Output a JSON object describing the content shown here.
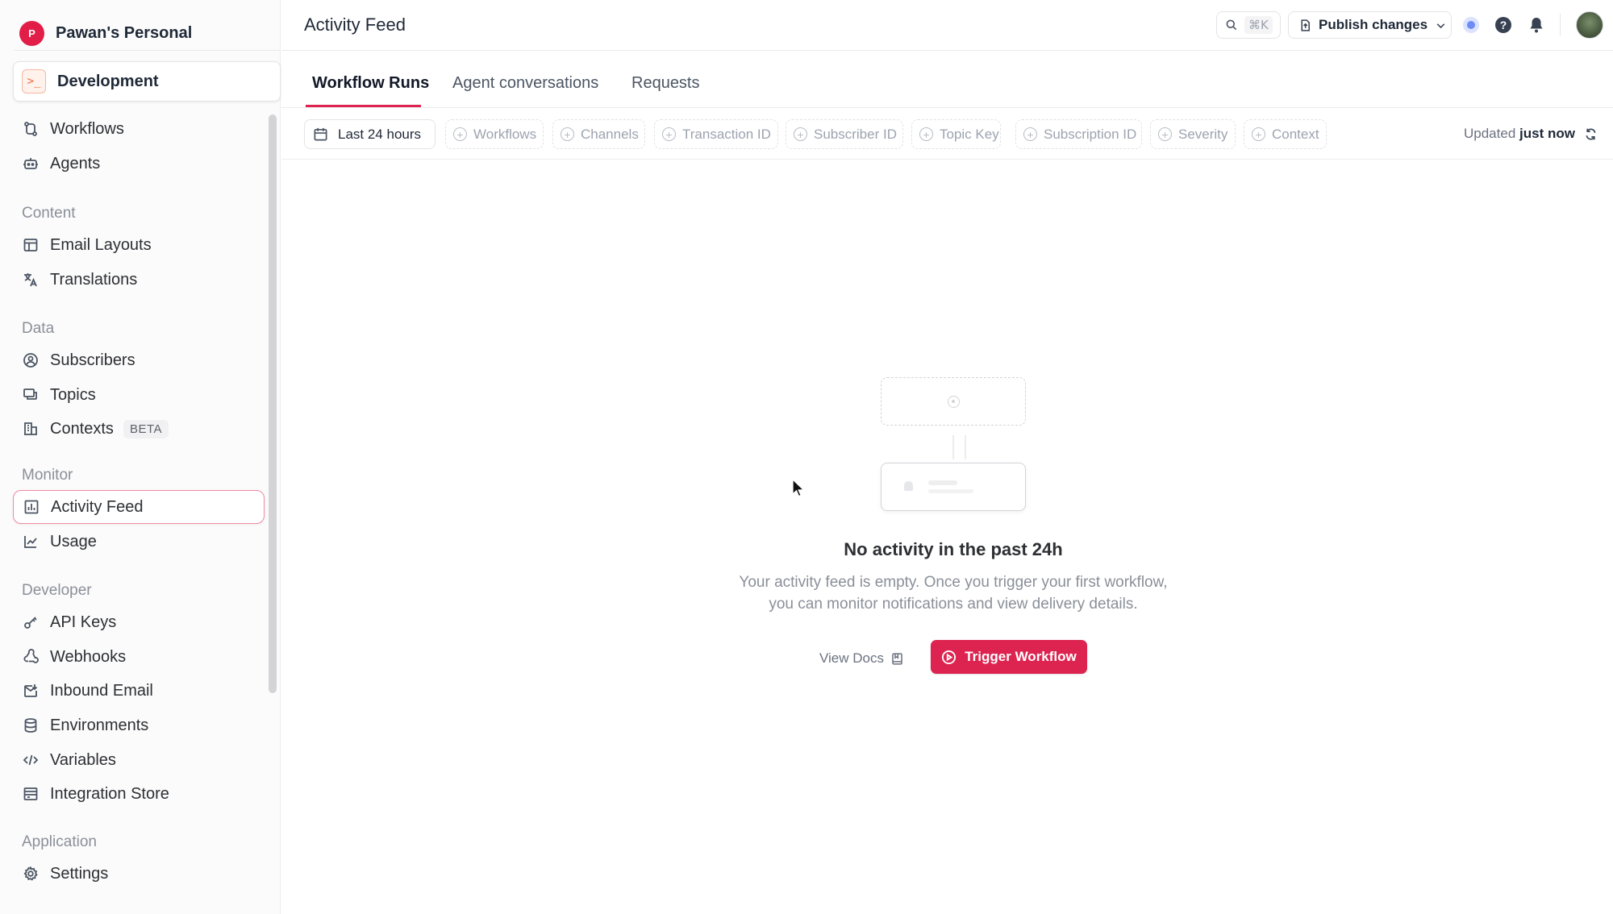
{
  "org": {
    "initial": "P",
    "name": "Pawan's Personal"
  },
  "environment": {
    "icon": ">_",
    "label": "Development"
  },
  "sidebar": {
    "top_items": [
      {
        "label": "Workflows",
        "icon": "workflow-icon"
      },
      {
        "label": "Agents",
        "icon": "bot-icon"
      }
    ],
    "sections": {
      "content": {
        "title": "Content",
        "items": [
          {
            "label": "Email Layouts"
          },
          {
            "label": "Translations"
          }
        ]
      },
      "data": {
        "title": "Data",
        "items": [
          {
            "label": "Subscribers"
          },
          {
            "label": "Topics"
          },
          {
            "label": "Contexts",
            "badge": "BETA"
          }
        ]
      },
      "monitor": {
        "title": "Monitor",
        "items": [
          {
            "label": "Activity Feed"
          },
          {
            "label": "Usage"
          }
        ]
      },
      "developer": {
        "title": "Developer",
        "items": [
          {
            "label": "API Keys"
          },
          {
            "label": "Webhooks"
          },
          {
            "label": "Inbound Email"
          },
          {
            "label": "Environments"
          },
          {
            "label": "Variables"
          },
          {
            "label": "Integration Store"
          }
        ]
      },
      "application": {
        "title": "Application",
        "items": [
          {
            "label": "Settings"
          }
        ]
      }
    },
    "active_item": "Activity Feed"
  },
  "header": {
    "title": "Activity Feed",
    "search_shortcut": "⌘K",
    "publish_label": "Publish changes"
  },
  "tabs": [
    {
      "label": "Workflow Runs",
      "active": true
    },
    {
      "label": "Agent conversations",
      "active": false
    },
    {
      "label": "Requests",
      "active": false
    }
  ],
  "filters": {
    "date_range": "Last 24 hours",
    "chips": [
      "Workflows",
      "Channels",
      "Transaction ID",
      "Subscriber ID",
      "Topic Key",
      "Subscription ID",
      "Severity",
      "Context"
    ],
    "updated_prefix": "Updated",
    "updated_value": "just now"
  },
  "empty_state": {
    "title": "No activity in the past 24h",
    "line1": "Your activity feed is empty. Once you trigger your first workflow,",
    "line2": "you can monitor notifications and view delivery details.",
    "view_docs": "View Docs",
    "trigger_label": "Trigger Workflow"
  },
  "colors": {
    "accent": "#dd2450",
    "org_avatar": "#e11d48",
    "env_accent": "#f26b3a",
    "active_border": "#f08aa0"
  }
}
